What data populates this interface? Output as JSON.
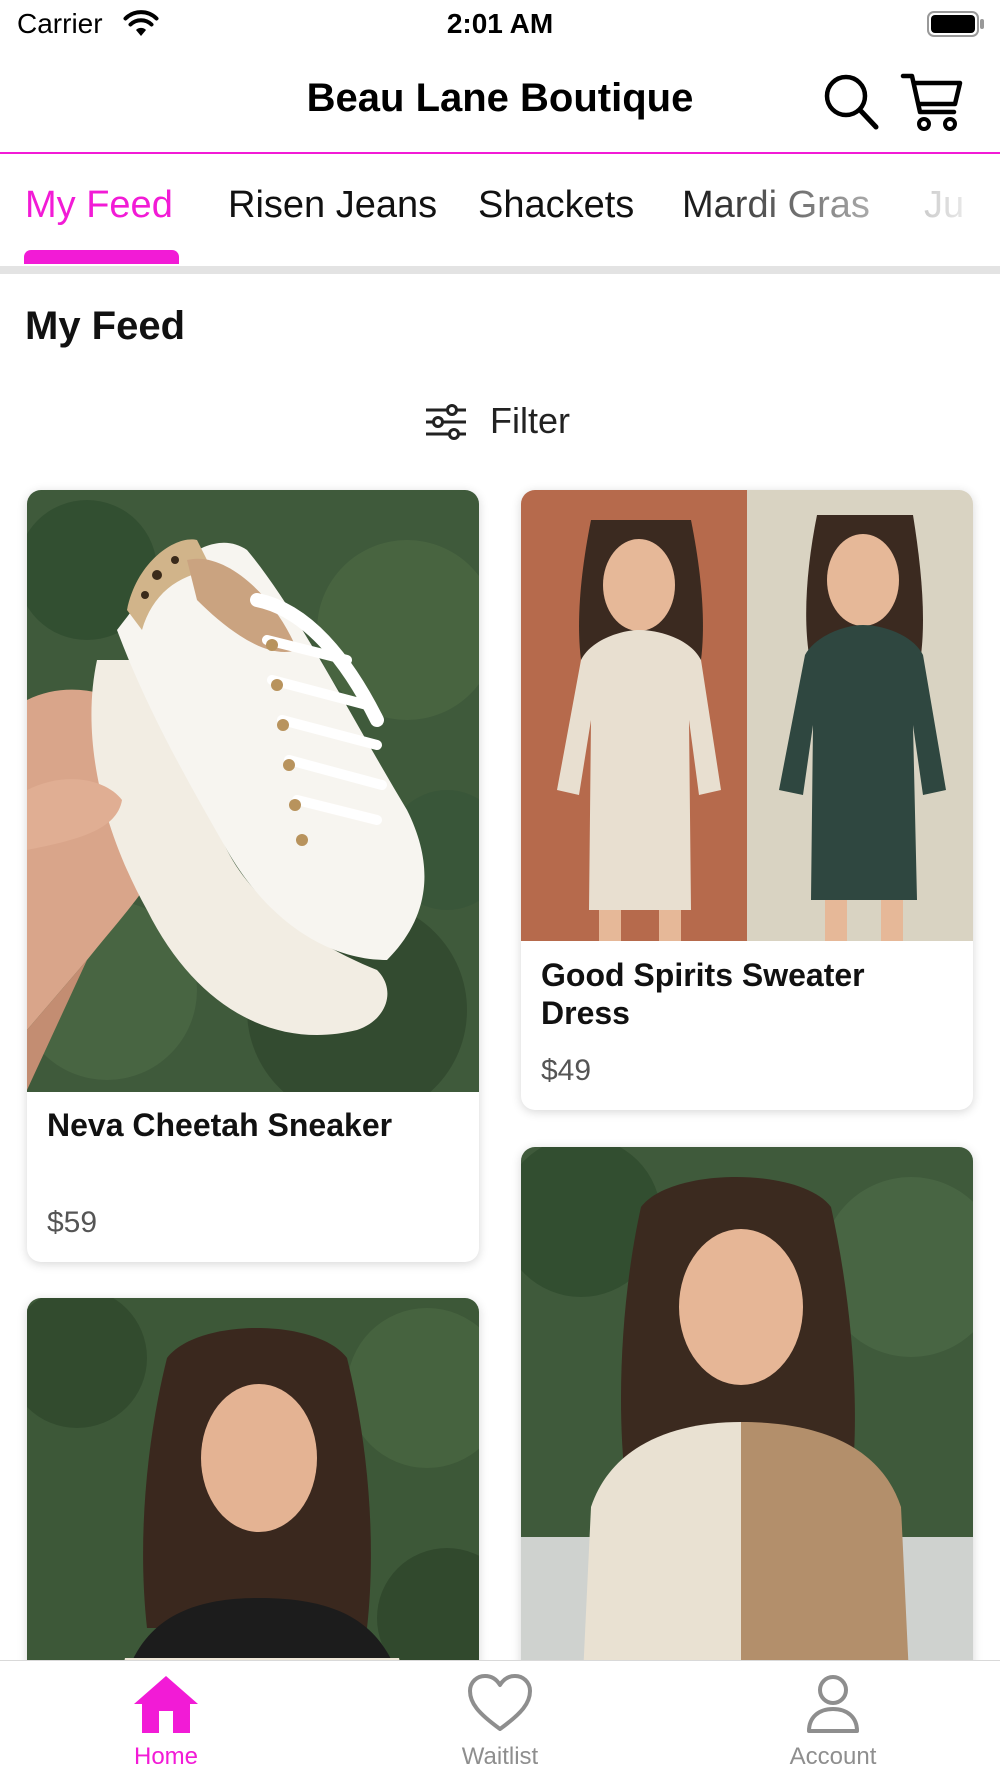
{
  "status_bar": {
    "carrier": "Carrier",
    "time": "2:01 AM"
  },
  "header": {
    "title": "Beau Lane Boutique",
    "search_icon": "search-icon",
    "cart_icon": "cart-icon"
  },
  "tabs": [
    {
      "label": "My Feed",
      "active": true
    },
    {
      "label": "Risen Jeans",
      "active": false
    },
    {
      "label": "Shackets",
      "active": false
    },
    {
      "label": "Mardi Gras",
      "active": false
    },
    {
      "label": "Ju",
      "active": false
    }
  ],
  "section": {
    "title": "My Feed"
  },
  "filter": {
    "label": "Filter",
    "icon": "sliders-icon"
  },
  "products": [
    {
      "name": "Neva Cheetah Sneaker",
      "price": "$59"
    },
    {
      "name": "Good Spirits Sweater Dress",
      "price": "$49"
    }
  ],
  "tabbar": [
    {
      "label": "Home",
      "icon": "home-icon",
      "active": true
    },
    {
      "label": "Waitlist",
      "icon": "heart-icon",
      "active": false
    },
    {
      "label": "Account",
      "icon": "person-icon",
      "active": false
    }
  ],
  "colors": {
    "accent": "#f21bd6",
    "divider": "#e3e3e3",
    "inactive": "#8e8e8e"
  }
}
